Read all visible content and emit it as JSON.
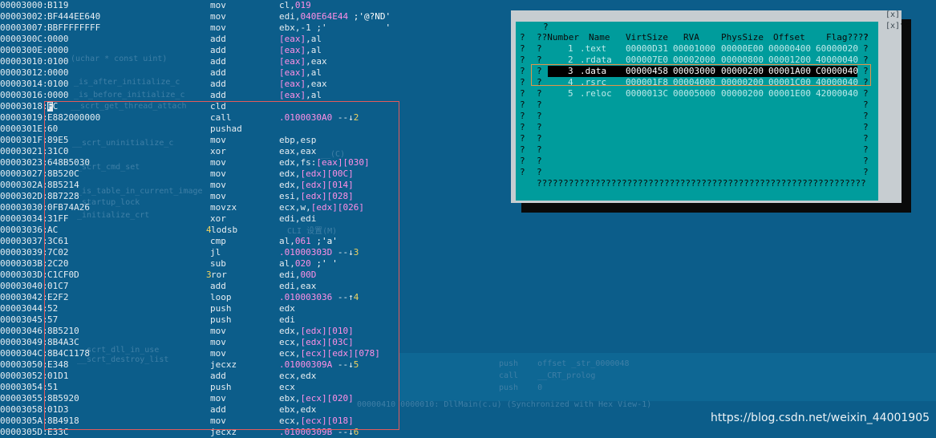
{
  "ghost_text": [
    "(uchar * const uint)",
    "_is_after_initialize_c",
    "_is_before_initialize_c",
    "__scrt_get_thread_attach",
    "__scrt_uninitialize_c",
    "__scrt_cmd_set",
    "_is_table_in_current_image",
    "_startup_lock",
    "_initialize_crt",
    "__scrt_dll_in_use",
    "__scrt_destroy_list",
    "__(C)",
    "CLI 设置(M)",
    "push    offset _str_0000048",
    "call    __CRT_prolog",
    "push    0",
    "00000410 0000010: DllMain(c.u) (Synchronized with Hex View-1)"
  ],
  "disasm_rows": [
    {
      "addr": "00003000:",
      "bytes": "B119",
      "mn": "mov",
      "op": [
        {
          "t": "reg",
          "v": "cl,"
        },
        {
          "t": "num",
          "v": "019"
        }
      ]
    },
    {
      "addr": "00003002:",
      "bytes": "BF444EE640",
      "mn": "mov",
      "op": [
        {
          "t": "reg",
          "v": "edi,"
        },
        {
          "t": "num",
          "v": "040E64E44"
        },
        {
          "t": "str",
          "v": " ;'@?ND'"
        }
      ]
    },
    {
      "addr": "00003007:",
      "bytes": "BBFFFFFFFF",
      "mn": "mov",
      "op": [
        {
          "t": "reg",
          "v": "ebx,-1 ;'"
        },
        {
          "t": "str",
          "v": "           '"
        }
      ]
    },
    {
      "addr": "0000300C:",
      "bytes": "0000",
      "mn": "add",
      "op": [
        {
          "t": "br",
          "v": "[eax]"
        },
        {
          "t": "reg",
          "v": ",al"
        }
      ]
    },
    {
      "addr": "0000300E:",
      "bytes": "0000",
      "mn": "add",
      "op": [
        {
          "t": "br",
          "v": "[eax]"
        },
        {
          "t": "reg",
          "v": ",al"
        }
      ]
    },
    {
      "addr": "00003010:",
      "bytes": "0100",
      "mn": "add",
      "op": [
        {
          "t": "br",
          "v": "[eax]"
        },
        {
          "t": "reg",
          "v": ",eax"
        }
      ]
    },
    {
      "addr": "00003012:",
      "bytes": "0000",
      "mn": "add",
      "op": [
        {
          "t": "br",
          "v": "[eax]"
        },
        {
          "t": "reg",
          "v": ",al"
        }
      ]
    },
    {
      "addr": "00003014:",
      "bytes": "0100",
      "mn": "add",
      "op": [
        {
          "t": "br",
          "v": "[eax]"
        },
        {
          "t": "reg",
          "v": ",eax"
        }
      ]
    },
    {
      "addr": "00003016:",
      "bytes": "0000",
      "mn": "add",
      "op": [
        {
          "t": "br",
          "v": "[eax]"
        },
        {
          "t": "reg",
          "v": ",al"
        }
      ]
    },
    {
      "addr": "00003018:",
      "bytes": "FC",
      "mn": "cld",
      "op": [],
      "sel": true
    },
    {
      "addr": "00003019:",
      "bytes": "E882000000",
      "mn": "call",
      "op": [
        {
          "t": "num",
          "v": ".0100030A0"
        },
        {
          "t": "arrow",
          "v": " --↓"
        },
        {
          "t": "tag",
          "v": "2"
        }
      ]
    },
    {
      "addr": "0000301E:",
      "bytes": "60",
      "mn": "pushad",
      "op": []
    },
    {
      "addr": "0000301F:",
      "bytes": "89E5",
      "mn": "mov",
      "op": [
        {
          "t": "reg",
          "v": "ebp,esp"
        }
      ]
    },
    {
      "addr": "00003021:",
      "bytes": "31C0",
      "mn": "xor",
      "op": [
        {
          "t": "reg",
          "v": "eax,eax"
        }
      ]
    },
    {
      "addr": "00003023:",
      "bytes": "648B5030",
      "mn": "mov",
      "op": [
        {
          "t": "reg",
          "v": "edx,fs:"
        },
        {
          "t": "br",
          "v": "[eax][030]"
        }
      ]
    },
    {
      "addr": "00003027:",
      "bytes": "8B520C",
      "mn": "mov",
      "op": [
        {
          "t": "reg",
          "v": "edx,"
        },
        {
          "t": "br",
          "v": "[edx][00C]"
        }
      ]
    },
    {
      "addr": "0000302A:",
      "bytes": "8B5214",
      "mn": "mov",
      "op": [
        {
          "t": "reg",
          "v": "edx,"
        },
        {
          "t": "br",
          "v": "[edx][014]"
        }
      ]
    },
    {
      "addr": "0000302D:",
      "bytes": "8B7228",
      "mn": "mov",
      "op": [
        {
          "t": "reg",
          "v": "esi,"
        },
        {
          "t": "br",
          "v": "[edx][028]"
        }
      ]
    },
    {
      "addr": "00003030:",
      "bytes": "0FB74A26",
      "mn": "movzx",
      "op": [
        {
          "t": "reg",
          "v": "ecx,w,"
        },
        {
          "t": "br",
          "v": "[edx][026]"
        }
      ]
    },
    {
      "addr": "00003034:",
      "bytes": "31FF",
      "mn": "xor",
      "op": [
        {
          "t": "reg",
          "v": "edi,edi"
        }
      ]
    },
    {
      "addr": "00003036:",
      "bytes": "AC",
      "mn": "lodsb",
      "op": [],
      "tag": "4"
    },
    {
      "addr": "00003037:",
      "bytes": "3C61",
      "mn": "cmp",
      "op": [
        {
          "t": "reg",
          "v": "al,"
        },
        {
          "t": "num",
          "v": "061"
        },
        {
          "t": "str",
          "v": " ;'a'"
        }
      ]
    },
    {
      "addr": "00003039:",
      "bytes": "7C02",
      "mn": "jl",
      "op": [
        {
          "t": "num",
          "v": ".01000303D"
        },
        {
          "t": "arrow",
          "v": " --↓"
        },
        {
          "t": "tag",
          "v": "3"
        }
      ]
    },
    {
      "addr": "0000303B:",
      "bytes": "2C20",
      "mn": "sub",
      "op": [
        {
          "t": "reg",
          "v": "al,"
        },
        {
          "t": "num",
          "v": "020"
        },
        {
          "t": "str",
          "v": " ;' '"
        }
      ]
    },
    {
      "addr": "0000303D:",
      "bytes": "C1CF0D",
      "mn": "ror",
      "op": [
        {
          "t": "reg",
          "v": "edi,"
        },
        {
          "t": "num",
          "v": "00D"
        }
      ],
      "tag": "3"
    },
    {
      "addr": "00003040:",
      "bytes": "01C7",
      "mn": "add",
      "op": [
        {
          "t": "reg",
          "v": "edi,eax"
        }
      ]
    },
    {
      "addr": "00003042:",
      "bytes": "E2F2",
      "mn": "loop",
      "op": [
        {
          "t": "num",
          "v": ".010003036"
        },
        {
          "t": "arrow",
          "v": " --↑"
        },
        {
          "t": "tag",
          "v": "4"
        }
      ]
    },
    {
      "addr": "00003044:",
      "bytes": "52",
      "mn": "push",
      "op": [
        {
          "t": "reg",
          "v": "edx"
        }
      ]
    },
    {
      "addr": "00003045:",
      "bytes": "57",
      "mn": "push",
      "op": [
        {
          "t": "reg",
          "v": "edi"
        }
      ]
    },
    {
      "addr": "00003046:",
      "bytes": "8B5210",
      "mn": "mov",
      "op": [
        {
          "t": "reg",
          "v": "edx,"
        },
        {
          "t": "br",
          "v": "[edx][010]"
        }
      ]
    },
    {
      "addr": "00003049:",
      "bytes": "8B4A3C",
      "mn": "mov",
      "op": [
        {
          "t": "reg",
          "v": "ecx,"
        },
        {
          "t": "br",
          "v": "[edx][03C]"
        }
      ]
    },
    {
      "addr": "0000304C:",
      "bytes": "8B4C1178",
      "mn": "mov",
      "op": [
        {
          "t": "reg",
          "v": "ecx,"
        },
        {
          "t": "br",
          "v": "[ecx][edx][078]"
        }
      ]
    },
    {
      "addr": "00003050:",
      "bytes": "E348",
      "mn": "jecxz",
      "op": [
        {
          "t": "num",
          "v": ".01000309A"
        },
        {
          "t": "arrow",
          "v": " --↓"
        },
        {
          "t": "tag",
          "v": "5"
        }
      ]
    },
    {
      "addr": "00003052:",
      "bytes": "01D1",
      "mn": "add",
      "op": [
        {
          "t": "reg",
          "v": "ecx,edx"
        }
      ]
    },
    {
      "addr": "00003054:",
      "bytes": "51",
      "mn": "push",
      "op": [
        {
          "t": "reg",
          "v": "ecx"
        }
      ]
    },
    {
      "addr": "00003055:",
      "bytes": "8B5920",
      "mn": "mov",
      "op": [
        {
          "t": "reg",
          "v": "ebx,"
        },
        {
          "t": "br",
          "v": "[ecx][020]"
        }
      ]
    },
    {
      "addr": "00003058:",
      "bytes": "01D3",
      "mn": "add",
      "op": [
        {
          "t": "reg",
          "v": "ebx,edx"
        }
      ]
    },
    {
      "addr": "0000305A:",
      "bytes": "8B4918",
      "mn": "mov",
      "op": [
        {
          "t": "reg",
          "v": "ecx,"
        },
        {
          "t": "br",
          "v": "[ecx][018]"
        }
      ]
    },
    {
      "addr": "0000305D:",
      "bytes": "E33C",
      "mn": "jecxz",
      "op": [
        {
          "t": "num",
          "v": ".01000309B"
        },
        {
          "t": "arrow",
          "v": " --↓"
        },
        {
          "t": "tag",
          "v": "6"
        }
      ]
    }
  ],
  "sections_dialog": {
    "title_mark": "?",
    "close_label": "[x]",
    "close_label2": "[x]",
    "title_right": "??",
    "headers": {
      "number": "??Number",
      "name": "Name",
      "virtsize": "VirtSize",
      "rva": "RVA",
      "physsize": "PhysSize",
      "offset": "Offset",
      "flags": "Flag????"
    },
    "sections": [
      {
        "num": "1",
        "name": ".text",
        "virtsize": "00000D31",
        "rva": "00001000",
        "physsize": "00000E00",
        "offset": "00000400",
        "flags": "60000020"
      },
      {
        "num": "2",
        "name": ".rdata",
        "virtsize": "000007E0",
        "rva": "00002000",
        "physsize": "00000800",
        "offset": "00001200",
        "flags": "40000040"
      },
      {
        "num": "3",
        "name": ".data",
        "virtsize": "00000458",
        "rva": "00003000",
        "physsize": "00000200",
        "offset": "00001A00",
        "flags": "C0000040",
        "selected": true
      },
      {
        "num": "4",
        "name": ".rsrc",
        "virtsize": "000001F8",
        "rva": "00004000",
        "physsize": "00000200",
        "offset": "00001C00",
        "flags": "40000040"
      },
      {
        "num": "5",
        "name": ".reloc",
        "virtsize": "0000013C",
        "rva": "00005000",
        "physsize": "00000200",
        "offset": "00001E00",
        "flags": "42000040"
      }
    ],
    "border_char": "?",
    "bottom_line": "??????????????????????????????????????????????????????????????"
  },
  "watermark": "https://blog.csdn.net/weixin_44001905",
  "colors": {
    "background": "#0c5d8a",
    "highlight": "#ff8fe6",
    "tag": "#f1d35f",
    "dialog": "#009c9c",
    "red_frame": "#e35b5b",
    "orange_frame": "#e49448"
  }
}
